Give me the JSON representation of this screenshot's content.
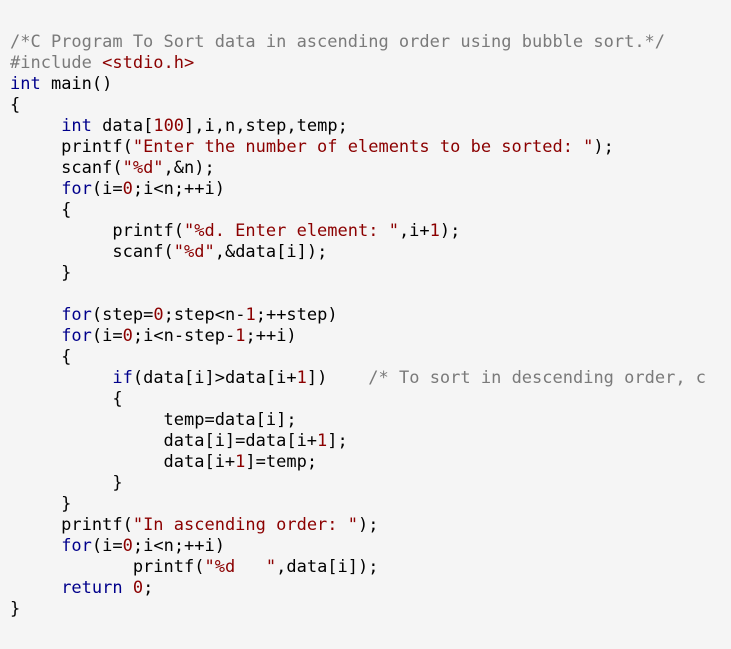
{
  "colors": {
    "background": "#f5f5f5",
    "plain": "#000000",
    "keyword": "#00008b",
    "string": "#8b0000",
    "number": "#8b0000",
    "comment": "#7a7a7a",
    "preproc": "#7a7a7a"
  },
  "code_lines": [
    [
      {
        "t": "comment",
        "s": "/*C Program To Sort data in ascending order using bubble sort.*/"
      }
    ],
    [
      {
        "t": "preproc",
        "s": "#include "
      },
      {
        "t": "string",
        "s": "<stdio.h>"
      }
    ],
    [
      {
        "t": "keyword",
        "s": "int"
      },
      {
        "t": "plain",
        "s": " main()"
      }
    ],
    [
      {
        "t": "plain",
        "s": "{"
      }
    ],
    [
      {
        "t": "plain",
        "s": "     "
      },
      {
        "t": "keyword",
        "s": "int"
      },
      {
        "t": "plain",
        "s": " data["
      },
      {
        "t": "number",
        "s": "100"
      },
      {
        "t": "plain",
        "s": "],i,n,step,temp;"
      }
    ],
    [
      {
        "t": "plain",
        "s": "     printf("
      },
      {
        "t": "string",
        "s": "\"Enter the number of elements to be sorted: \""
      },
      {
        "t": "plain",
        "s": ");"
      }
    ],
    [
      {
        "t": "plain",
        "s": "     scanf("
      },
      {
        "t": "string",
        "s": "\"%d\""
      },
      {
        "t": "plain",
        "s": ",&n);"
      }
    ],
    [
      {
        "t": "plain",
        "s": "     "
      },
      {
        "t": "keyword",
        "s": "for"
      },
      {
        "t": "plain",
        "s": "(i="
      },
      {
        "t": "number",
        "s": "0"
      },
      {
        "t": "plain",
        "s": ";i<n;++i)"
      }
    ],
    [
      {
        "t": "plain",
        "s": "     {"
      }
    ],
    [
      {
        "t": "plain",
        "s": "          printf("
      },
      {
        "t": "string",
        "s": "\"%d. Enter element: \""
      },
      {
        "t": "plain",
        "s": ",i+"
      },
      {
        "t": "number",
        "s": "1"
      },
      {
        "t": "plain",
        "s": ");"
      }
    ],
    [
      {
        "t": "plain",
        "s": "          scanf("
      },
      {
        "t": "string",
        "s": "\"%d\""
      },
      {
        "t": "plain",
        "s": ",&data[i]);"
      }
    ],
    [
      {
        "t": "plain",
        "s": "     }"
      }
    ],
    [
      {
        "t": "plain",
        "s": ""
      }
    ],
    [
      {
        "t": "plain",
        "s": "     "
      },
      {
        "t": "keyword",
        "s": "for"
      },
      {
        "t": "plain",
        "s": "(step="
      },
      {
        "t": "number",
        "s": "0"
      },
      {
        "t": "plain",
        "s": ";step<n-"
      },
      {
        "t": "number",
        "s": "1"
      },
      {
        "t": "plain",
        "s": ";++step)"
      }
    ],
    [
      {
        "t": "plain",
        "s": "     "
      },
      {
        "t": "keyword",
        "s": "for"
      },
      {
        "t": "plain",
        "s": "(i="
      },
      {
        "t": "number",
        "s": "0"
      },
      {
        "t": "plain",
        "s": ";i<n-step-"
      },
      {
        "t": "number",
        "s": "1"
      },
      {
        "t": "plain",
        "s": ";++i)"
      }
    ],
    [
      {
        "t": "plain",
        "s": "     {"
      }
    ],
    [
      {
        "t": "plain",
        "s": "          "
      },
      {
        "t": "keyword",
        "s": "if"
      },
      {
        "t": "plain",
        "s": "(data[i]>data[i+"
      },
      {
        "t": "number",
        "s": "1"
      },
      {
        "t": "plain",
        "s": "])    "
      },
      {
        "t": "comment",
        "s": "/* To sort in descending order, c"
      }
    ],
    [
      {
        "t": "plain",
        "s": "          {"
      }
    ],
    [
      {
        "t": "plain",
        "s": "               temp=data[i];"
      }
    ],
    [
      {
        "t": "plain",
        "s": "               data[i]=data[i+"
      },
      {
        "t": "number",
        "s": "1"
      },
      {
        "t": "plain",
        "s": "];"
      }
    ],
    [
      {
        "t": "plain",
        "s": "               data[i+"
      },
      {
        "t": "number",
        "s": "1"
      },
      {
        "t": "plain",
        "s": "]=temp;"
      }
    ],
    [
      {
        "t": "plain",
        "s": "          }"
      }
    ],
    [
      {
        "t": "plain",
        "s": "     }"
      }
    ],
    [
      {
        "t": "plain",
        "s": "     printf("
      },
      {
        "t": "string",
        "s": "\"In ascending order: \""
      },
      {
        "t": "plain",
        "s": ");"
      }
    ],
    [
      {
        "t": "plain",
        "s": "     "
      },
      {
        "t": "keyword",
        "s": "for"
      },
      {
        "t": "plain",
        "s": "(i="
      },
      {
        "t": "number",
        "s": "0"
      },
      {
        "t": "plain",
        "s": ";i<n;++i)"
      }
    ],
    [
      {
        "t": "plain",
        "s": "            printf("
      },
      {
        "t": "string",
        "s": "\"%d   \""
      },
      {
        "t": "plain",
        "s": ",data[i]);"
      }
    ],
    [
      {
        "t": "plain",
        "s": "     "
      },
      {
        "t": "keyword",
        "s": "return"
      },
      {
        "t": "plain",
        "s": " "
      },
      {
        "t": "number",
        "s": "0"
      },
      {
        "t": "plain",
        "s": ";"
      }
    ],
    [
      {
        "t": "plain",
        "s": "}"
      }
    ]
  ]
}
